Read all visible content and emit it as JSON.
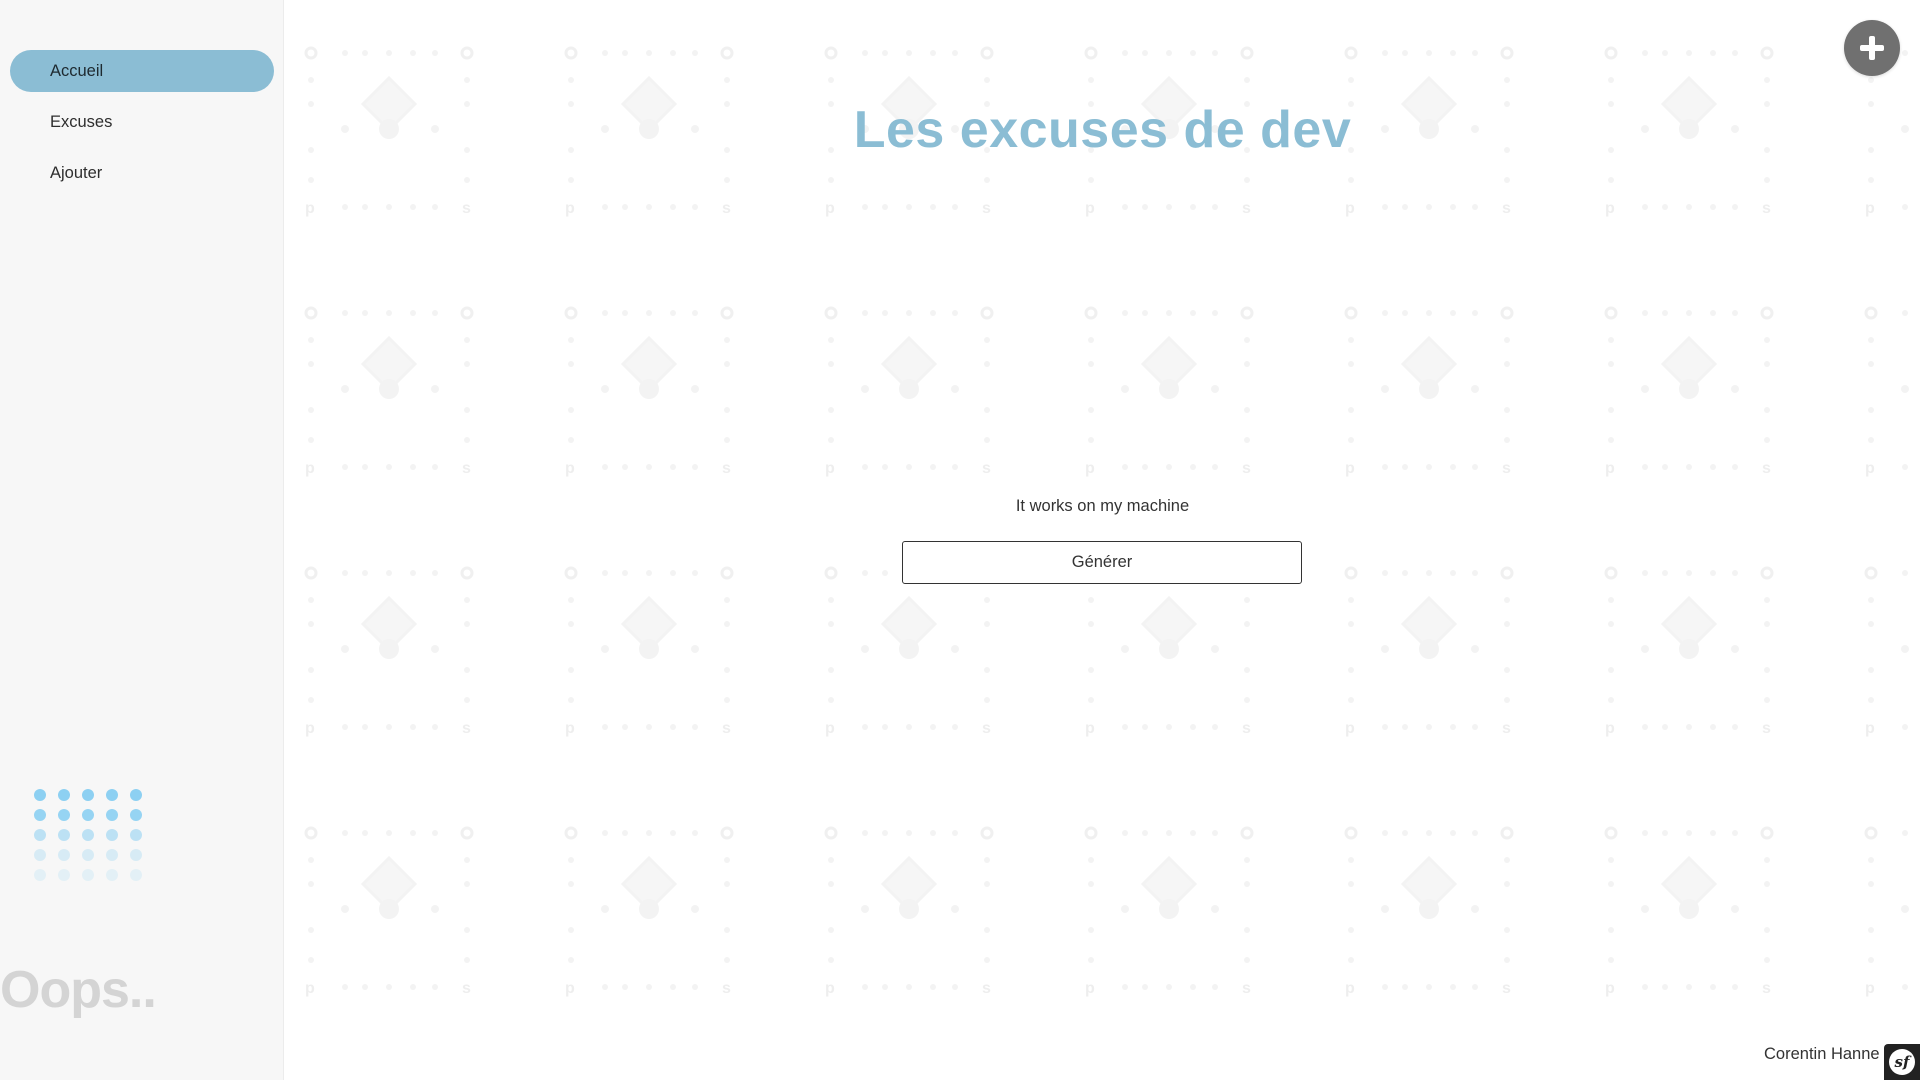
{
  "sidebar": {
    "items": [
      {
        "label": "Accueil",
        "active": true
      },
      {
        "label": "Excuses",
        "active": false
      },
      {
        "label": "Ajouter",
        "active": false
      }
    ],
    "decoration_text": "Oops.."
  },
  "main": {
    "title": "Les excuses de dev",
    "excuse_text": "It works on my machine",
    "generate_label": "Générer",
    "author": "Corentin Hanne"
  },
  "fab": {
    "icon": "plus-icon"
  },
  "toolbar_badge": {
    "icon": "symfony-icon",
    "glyph": "sf"
  },
  "colors": {
    "accent": "#8bbdd4",
    "sidebar_bg": "#f7f7f7",
    "fab_bg": "#707070",
    "dots": "#8dd0f2",
    "oops_text": "#d4d4d4"
  }
}
